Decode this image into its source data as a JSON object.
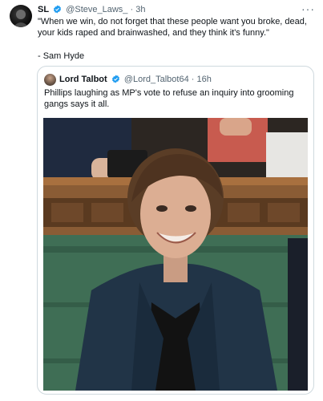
{
  "tweet": {
    "name": "SL",
    "handle": "@Steve_Laws_",
    "separator": "·",
    "time": "3h",
    "more": "···",
    "text": "\"When we win, do not forget that these people want you broke, dead, your kids raped and brainwashed, and they think it's funny.\"",
    "signature": "- Sam Hyde"
  },
  "quoted": {
    "name": "Lord Talbot",
    "handle": "@Lord_Talbot64",
    "separator": "·",
    "time": "16h",
    "text": "Phillips laughing as MP's vote to refuse an inquiry into grooming gangs says it all."
  },
  "colors": {
    "verified": "#1d9bf0",
    "muted": "#536471",
    "border": "#cfd9de",
    "bench_green": "#3f6e55"
  }
}
